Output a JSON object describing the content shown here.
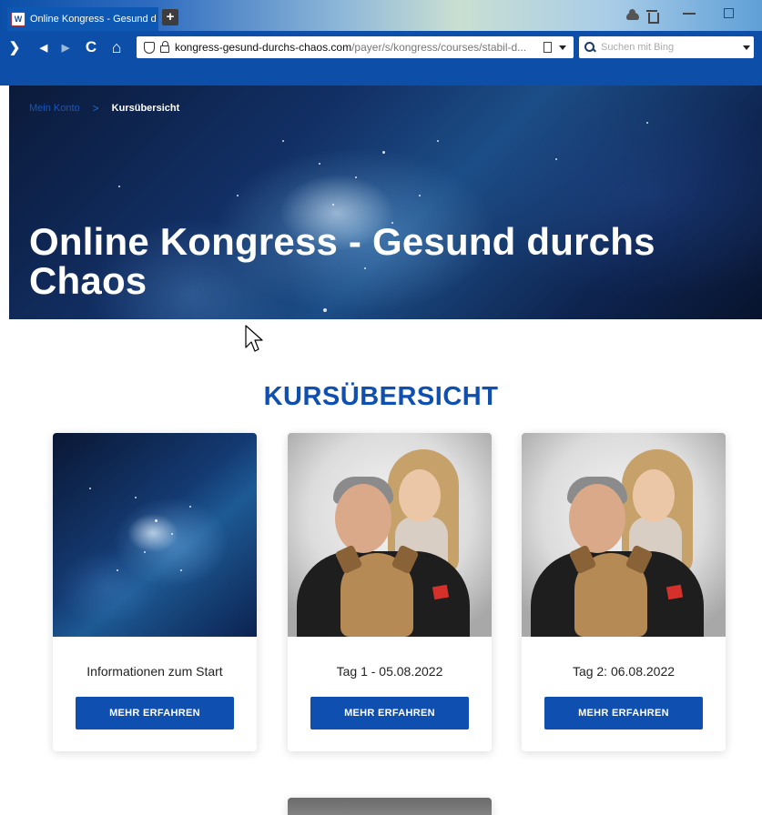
{
  "browser": {
    "tab_title": "Online Kongress - Gesund d",
    "favicon_text": "W",
    "newtab_label": "+",
    "nav": {
      "forward": "❯",
      "first": "◀",
      "last": "▶",
      "reload": "C",
      "home": "⌂"
    },
    "url_host": "kongress-gesund-durchs-chaos.com",
    "url_path": "/payer/s/kongress/courses/stabil-d...",
    "search_placeholder": "Suchen mit Bing"
  },
  "breadcrumb": {
    "parent": "Mein Konto",
    "separator": ">",
    "current": "Kursübersicht"
  },
  "hero": {
    "title": "Online Kongress - Gesund durchs Chaos"
  },
  "section": {
    "title": "KURSÜBERSICHT"
  },
  "courses": [
    {
      "caption": "Informationen zum Start",
      "button": "MEHR ERFAHREN",
      "image": "space-image"
    },
    {
      "caption": "Tag 1 - 05.08.2022",
      "button": "MEHR ERFAHREN",
      "image": "speakers-photo"
    },
    {
      "caption": "Tag 2: 06.08.2022",
      "button": "MEHR ERFAHREN",
      "image": "speakers-photo"
    }
  ],
  "colors": {
    "brand_blue": "#0e4fb0",
    "browser_blue": "#0d4fa8"
  }
}
